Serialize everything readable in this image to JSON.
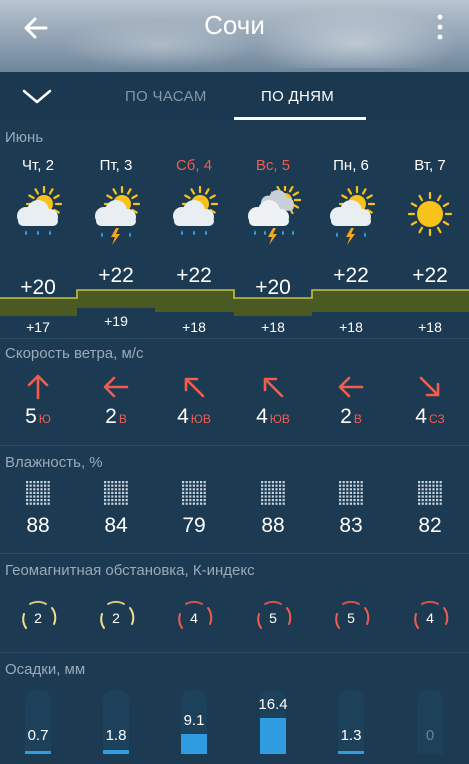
{
  "header": {
    "title": "Сочи"
  },
  "tabs": {
    "hourly": "ПО ЧАСАМ",
    "daily": "ПО ДНЯМ"
  },
  "month": "Июнь",
  "days": [
    {
      "label": "Чт, 2",
      "weekend": false,
      "icon": "partly-cloudy-rain-icon",
      "tmax": "+20",
      "tmin": "+17",
      "tmax_value": 20,
      "wind_speed": "5",
      "wind_dir": "Ю",
      "wind_arrow": "up",
      "humidity": "88",
      "k_index": "2",
      "k_level": 2,
      "precip": "0.7",
      "precip_value": 0.7
    },
    {
      "label": "Пт, 3",
      "weekend": false,
      "icon": "partly-cloudy-thunder-icon",
      "tmax": "+22",
      "tmin": "+19",
      "tmax_value": 22,
      "wind_speed": "2",
      "wind_dir": "В",
      "wind_arrow": "left",
      "humidity": "84",
      "k_index": "2",
      "k_level": 2,
      "precip": "1.8",
      "precip_value": 1.8
    },
    {
      "label": "Сб, 4",
      "weekend": true,
      "icon": "partly-cloudy-rain-icon",
      "tmax": "+22",
      "tmin": "+18",
      "tmax_value": 22,
      "wind_speed": "4",
      "wind_dir": "ЮВ",
      "wind_arrow": "up-left",
      "humidity": "79",
      "k_index": "4",
      "k_level": 4,
      "precip": "9.1",
      "precip_value": 9.1
    },
    {
      "label": "Вс, 5",
      "weekend": true,
      "icon": "cloudy-thunder-rain-icon",
      "tmax": "+20",
      "tmin": "+18",
      "tmax_value": 20,
      "wind_speed": "4",
      "wind_dir": "ЮВ",
      "wind_arrow": "up-left",
      "humidity": "88",
      "k_index": "5",
      "k_level": 5,
      "precip": "16.4",
      "precip_value": 16.4
    },
    {
      "label": "Пн, 6",
      "weekend": false,
      "icon": "partly-cloudy-thunder-icon",
      "tmax": "+22",
      "tmin": "+18",
      "tmax_value": 22,
      "wind_speed": "2",
      "wind_dir": "В",
      "wind_arrow": "left",
      "humidity": "83",
      "k_index": "5",
      "k_level": 5,
      "precip": "1.3",
      "precip_value": 1.3
    },
    {
      "label": "Вт, 7",
      "weekend": false,
      "icon": "sun-icon",
      "tmax": "+22",
      "tmin": "+18",
      "tmax_value": 22,
      "wind_speed": "4",
      "wind_dir": "СЗ",
      "wind_arrow": "down-right",
      "humidity": "82",
      "k_index": "4",
      "k_level": 4,
      "precip": "0",
      "precip_value": 0
    }
  ],
  "sections": {
    "wind": "Скорость ветра, м/с",
    "humidity": "Влажность, %",
    "geomagnetic": "Геомагнитная обстановка, К-индекс",
    "precip": "Осадки, мм"
  },
  "colors": {
    "background": "#1c3a52",
    "accent_red": "#ef5d4f",
    "temp_band": "#4a5a22",
    "temp_line": "#c9c13a",
    "k_low": "#f2e08a",
    "precip_bar": "#2f9be0"
  }
}
